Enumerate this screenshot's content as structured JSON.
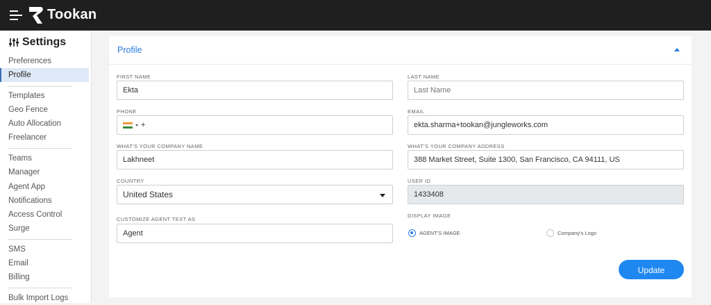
{
  "app": {
    "brand": "Tookan"
  },
  "colors": {
    "accent": "#2b7be0",
    "button": "#1e88f0",
    "topbar": "#1f1f1f"
  },
  "sidebar": {
    "title": "Settings",
    "items": [
      {
        "label": "Preferences"
      },
      {
        "label": "Profile",
        "active": true
      },
      {
        "label": "Templates"
      },
      {
        "label": "Geo Fence"
      },
      {
        "label": "Auto Allocation"
      },
      {
        "label": "Freelancer"
      },
      {
        "label": "Teams"
      },
      {
        "label": "Manager"
      },
      {
        "label": "Agent App"
      },
      {
        "label": "Notifications"
      },
      {
        "label": "Access Control"
      },
      {
        "label": "Surge"
      },
      {
        "label": "SMS"
      },
      {
        "label": "Email"
      },
      {
        "label": "Billing"
      },
      {
        "label": "Bulk Import Logs"
      }
    ]
  },
  "profile": {
    "section_title": "Profile",
    "first_name": {
      "label": "FIRST NAME",
      "value": "Ekta"
    },
    "last_name": {
      "label": "LAST NAME",
      "value": "",
      "placeholder": "Last Name"
    },
    "phone": {
      "label": "PHONE",
      "country_flag": "india-flag-icon",
      "dial_code": "+"
    },
    "email": {
      "label": "EMAIL",
      "value": "ekta.sharma+tookan@jungleworks.com"
    },
    "company_name": {
      "label": "WHAT'S YOUR COMPANY NAME",
      "value": "Lakhneet"
    },
    "company_address": {
      "label": "WHAT'S YOUR COMPANY ADDRESS",
      "value": "388 Market Street, Suite 1300, San Francisco, CA 94111, US"
    },
    "country": {
      "label": "COUNTRY",
      "value": "United States"
    },
    "user_id": {
      "label": "USER ID",
      "value": "1433408"
    },
    "agent_text": {
      "label": "CUSTOMIZE AGENT TEXT AS",
      "value": "Agent"
    },
    "display_image": {
      "label": "DISPLAY IMAGE",
      "options": [
        {
          "label": "AGENT'S IMAGE",
          "selected": true
        },
        {
          "label": "Company's Logo",
          "selected": false
        }
      ]
    },
    "update_label": "Update"
  }
}
